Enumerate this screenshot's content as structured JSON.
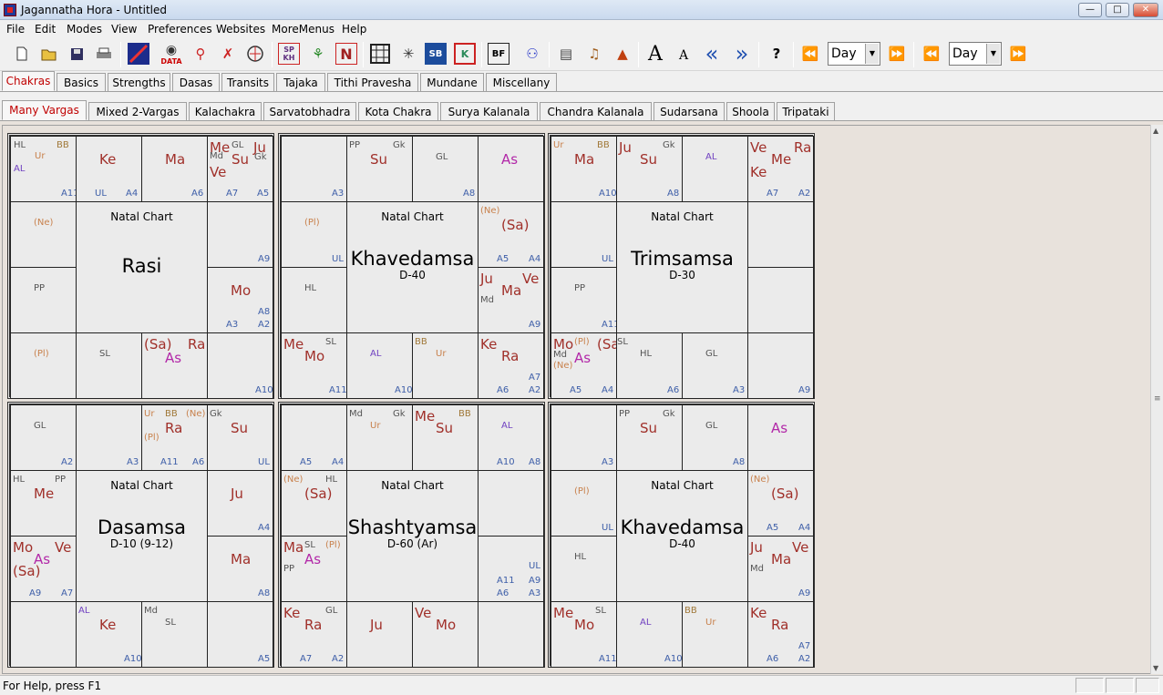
{
  "window": {
    "title": "Jagannatha Hora - Untitled",
    "min": "—",
    "max": "□",
    "close": "✕"
  },
  "menu": [
    "File",
    "Edit",
    "Modes",
    "View",
    "Preferences",
    "Websites",
    "MoreMenus",
    "Help"
  ],
  "toolbar": {
    "data_label": "DATA",
    "sp_label": "SP",
    "kh_label": "KH",
    "n_label": "N",
    "sb_label": "SB",
    "bf_label": "BF",
    "font_big": "A",
    "font_small": "A",
    "back": "«",
    "fwd": "»",
    "help": "?",
    "combo1": "Day",
    "combo2": "Day",
    "icons": [
      "new-icon",
      "open-icon",
      "save-icon",
      "print-icon",
      "chart-icon",
      "data-icon",
      "transit-icon",
      "sign-icon",
      "dasa-icon",
      "sp-kh-icon",
      "person-icon",
      "n-icon",
      "grid-icon",
      "sun-icon",
      "sb-icon",
      "k-icon",
      "bf-icon",
      "people-icon",
      "book-icon",
      "music-icon",
      "temple-icon"
    ]
  },
  "tabs1": [
    "Chakras",
    "Basics",
    "Strengths",
    "Dasas",
    "Transits",
    "Tajaka",
    "Tithi Pravesha",
    "Mundane",
    "Miscellany"
  ],
  "tabs2": [
    "Many Vargas",
    "Mixed 2-Vargas",
    "Kalachakra",
    "Sarvatobhadra",
    "Kota Chakra",
    "Surya Kalanala",
    "Chandra Kalanala",
    "Sudarsana",
    "Shoola",
    "Tripataki"
  ],
  "charts": [
    {
      "natal": "Natal Chart",
      "name": "Rasi",
      "div": ""
    },
    {
      "natal": "Natal Chart",
      "name": "Khavedamsa",
      "div": "D-40"
    },
    {
      "natal": "Natal Chart",
      "name": "Trimsamsa",
      "div": "D-30"
    },
    {
      "natal": "Natal Chart",
      "name": "Dasamsa",
      "div": "D-10 (9-12)"
    },
    {
      "natal": "Natal Chart",
      "name": "Shashtyamsa",
      "div": "D-60 (Ar)"
    },
    {
      "natal": "Natal Chart",
      "name": "Khavedamsa",
      "div": "D-40"
    }
  ],
  "status": {
    "help": "For Help, press F1"
  }
}
